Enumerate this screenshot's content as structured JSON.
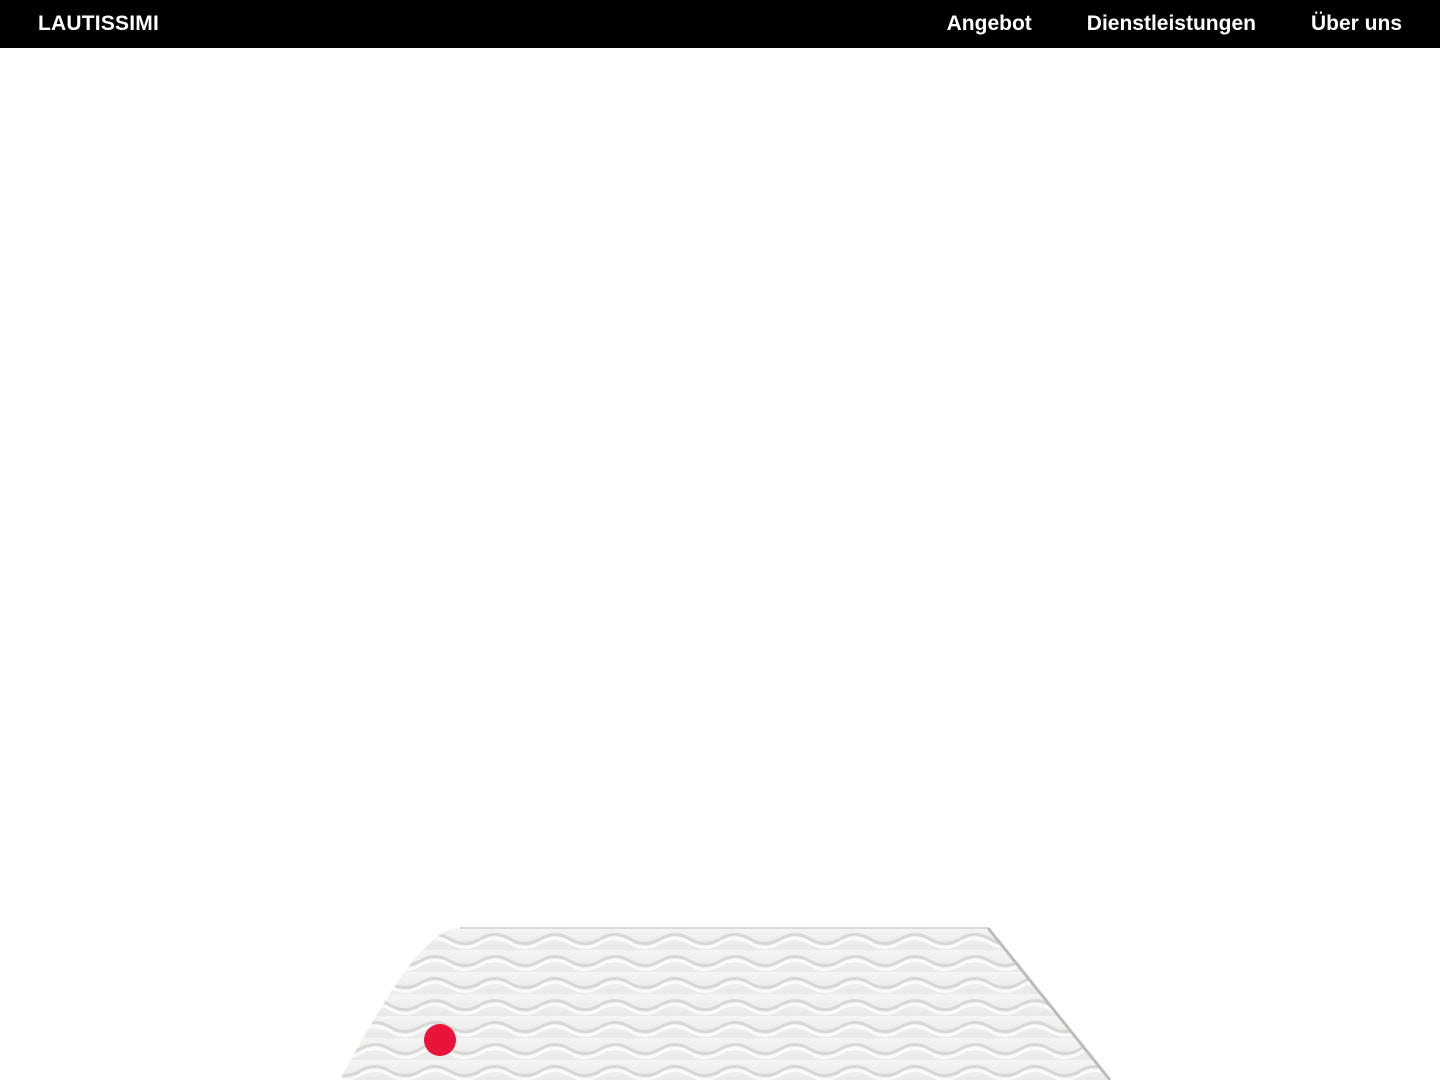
{
  "header": {
    "brand": "LAUTISSIMI",
    "nav": [
      {
        "label": "Angebot"
      },
      {
        "label": "Dienstleistungen"
      },
      {
        "label": "Über uns"
      }
    ]
  },
  "hero": {
    "product_image": "mattress-topper",
    "hotspot_color": "#e8123a"
  },
  "colors": {
    "header_bg": "#000000",
    "header_text": "#ffffff",
    "page_bg": "#ffffff",
    "accent": "#e8123a"
  }
}
